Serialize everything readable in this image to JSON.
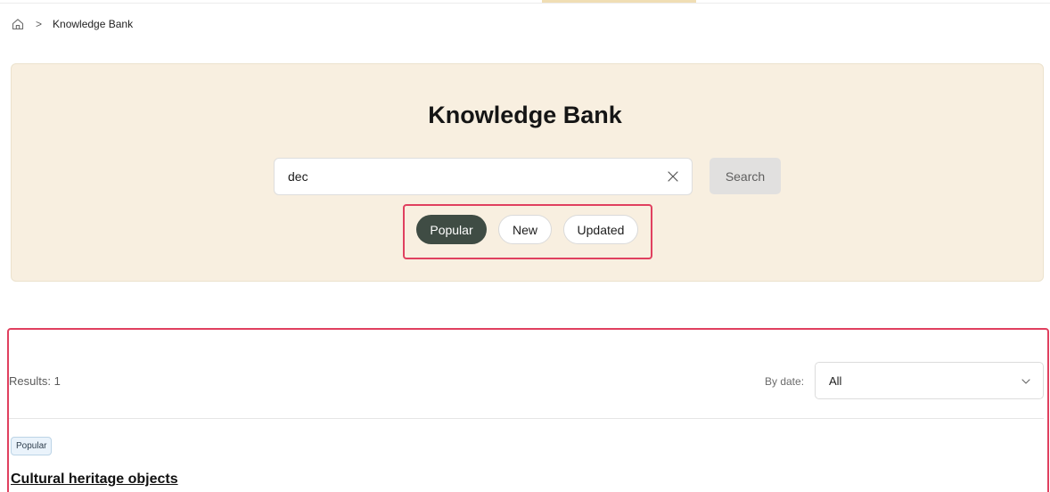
{
  "breadcrumb": {
    "home_icon": "home-icon",
    "separator": ">",
    "current": "Knowledge Bank"
  },
  "hero": {
    "title": "Knowledge Bank",
    "search": {
      "value": "dec",
      "clear_icon": "close-icon",
      "button_label": "Search"
    },
    "filters": [
      {
        "label": "Popular",
        "active": true
      },
      {
        "label": "New",
        "active": false
      },
      {
        "label": "Updated",
        "active": false
      }
    ]
  },
  "results": {
    "count_label": "Results: 1",
    "sort_label": "By date:",
    "sort_value": "All",
    "items": [
      {
        "tag": "Popular",
        "title": "Cultural heritage objects"
      }
    ]
  },
  "colors": {
    "hero_bg": "#f8efe0",
    "active_pill": "#3f4c44",
    "highlight_frame": "#e0405f",
    "tag_bg": "#eaf3fb"
  }
}
